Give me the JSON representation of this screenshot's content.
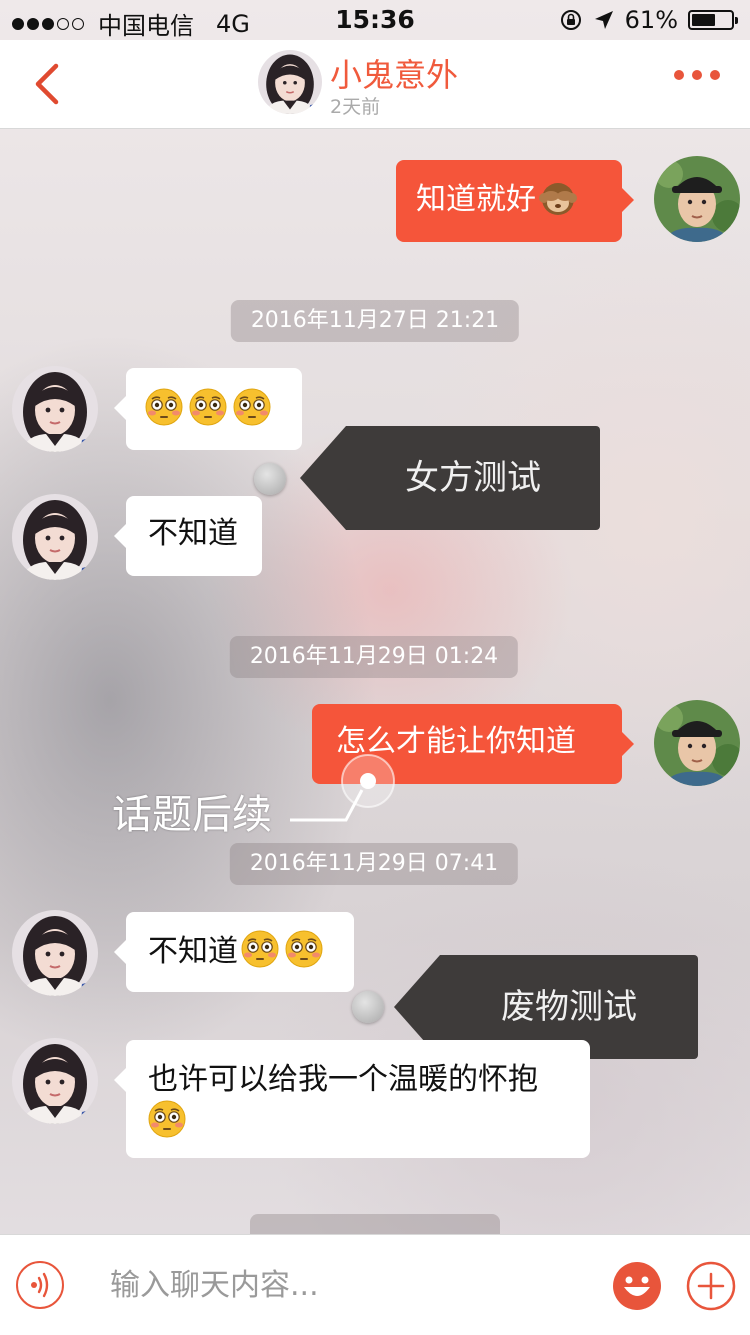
{
  "status_bar": {
    "carrier": "中国电信",
    "network": "4G",
    "time": "15:36",
    "battery": "61%",
    "battery_level": 0.61
  },
  "nav": {
    "title": "小鬼意外",
    "subtitle": "2天前"
  },
  "timestamps": [
    "2016年11月27日 21:21",
    "2016年11月29日 01:24",
    "2016年11月29日 07:41"
  ],
  "messages": [
    {
      "side": "out",
      "text": "知道就好",
      "emoji": "see-no-evil-monkey"
    },
    {
      "side": "in",
      "text": "",
      "emoji": "flushed-face x3"
    },
    {
      "side": "in",
      "text": "不知道"
    },
    {
      "side": "out",
      "text": "怎么才能让你知道"
    },
    {
      "side": "in",
      "text": "不知道",
      "emoji": "flushed-face x2"
    },
    {
      "side": "in",
      "text": "也许可以给我一个温暖的怀抱",
      "emoji": "flushed-face"
    }
  ],
  "annotations": {
    "tag1": "女方测试",
    "tag2": "废物测试",
    "topic": "话题后续"
  },
  "input": {
    "placeholder": "输入聊天内容..."
  },
  "colors": {
    "accent": "#f05a3c",
    "bubble_out": "#f5553a",
    "bubble_in": "#ffffff",
    "tag_bg": "#3e3b3a"
  }
}
